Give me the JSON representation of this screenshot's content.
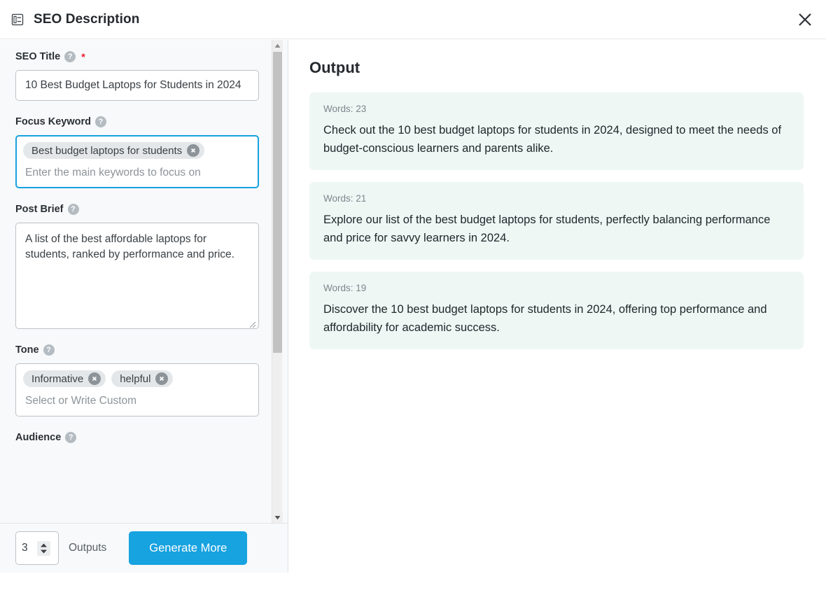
{
  "header": {
    "title": "SEO Description",
    "icon": "form-layout-icon",
    "close_label": "Close"
  },
  "form": {
    "fields": [
      {
        "id": "seo-title",
        "label": "SEO Title",
        "required_marker": "*",
        "help": "?",
        "value": "10 Best Budget Laptops for Students in 2024"
      },
      {
        "id": "focus-keyword",
        "label": "Focus Keyword",
        "help": "?",
        "placeholder": "Enter the main keywords to focus on",
        "chips": [
          "Best budget laptops for students"
        ]
      },
      {
        "id": "post-brief",
        "label": "Post Brief",
        "help": "?",
        "value": "A list of the best affordable laptops for students, ranked by performance and price."
      },
      {
        "id": "tone",
        "label": "Tone",
        "help": "?",
        "placeholder": "Select or Write Custom",
        "chips": [
          "Informative",
          "helpful"
        ]
      },
      {
        "id": "audience",
        "label": "Audience",
        "help": "?"
      }
    ]
  },
  "footer": {
    "outputs_count": "3",
    "outputs_label": "Outputs",
    "generate_label": "Generate More"
  },
  "output": {
    "title": "Output",
    "cards": [
      {
        "words_label": "Words: 23",
        "text": "Check out the 10 best budget laptops for students in 2024, designed to meet the needs of budget-conscious learners and parents alike."
      },
      {
        "words_label": "Words: 21",
        "text": "Explore our list of the best budget laptops for students, perfectly balancing performance and price for savvy learners in 2024."
      },
      {
        "words_label": "Words: 19",
        "text": "Discover the 10 best budget laptops for students in 2024, offering top performance and affordability for academic success."
      }
    ]
  },
  "colors": {
    "accent": "#17a2e0",
    "panel_bg": "#f7f9fa",
    "card_bg": "#eef7f4",
    "focus_border": "#17a2e0",
    "required": "#e8192c"
  }
}
